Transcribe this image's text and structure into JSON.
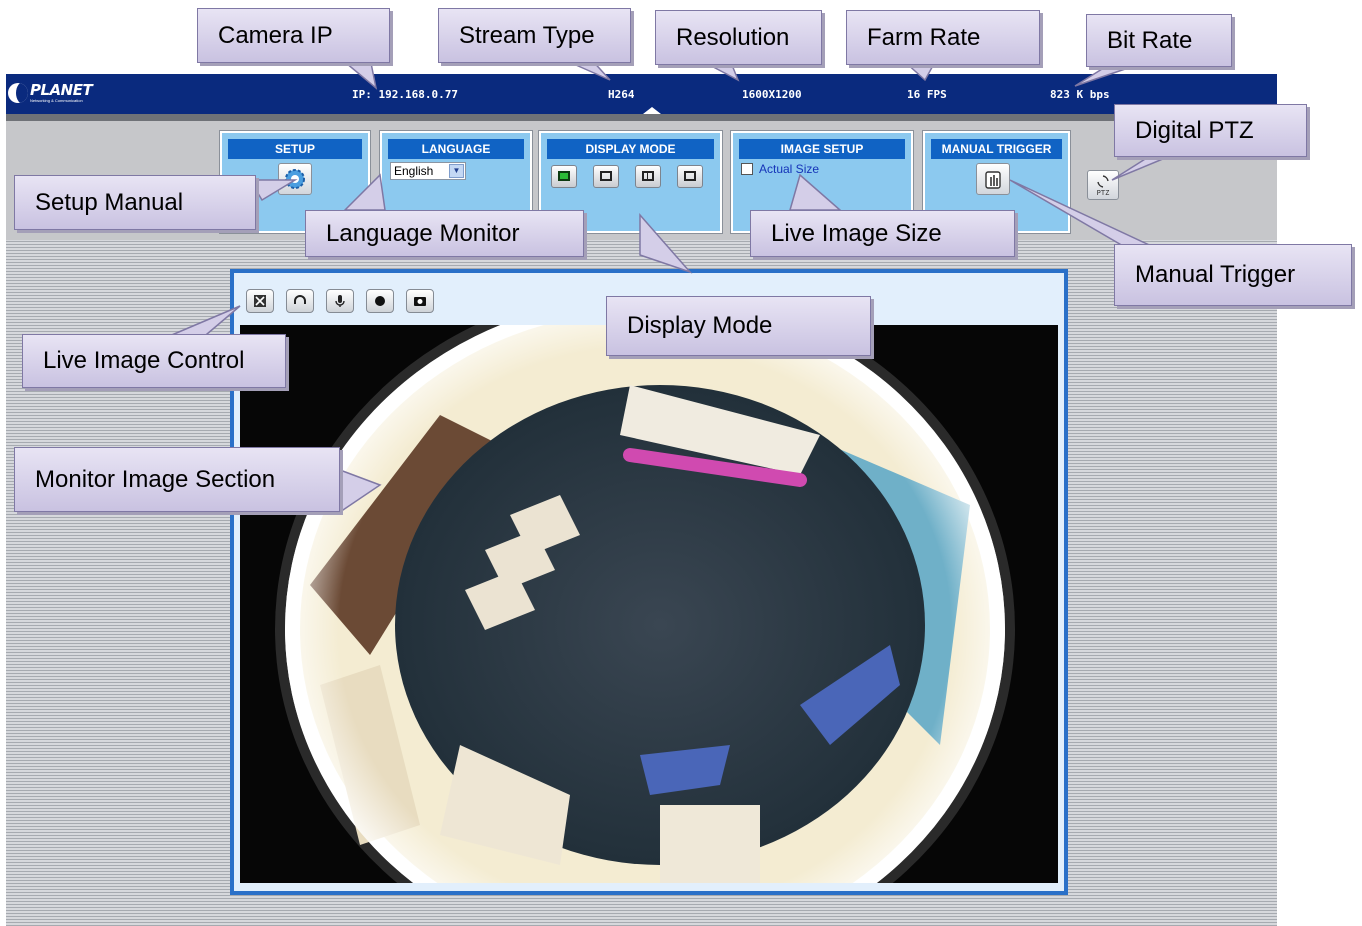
{
  "brand": {
    "name": "PLANET",
    "tagline": "Networking & Communication"
  },
  "status": {
    "ip": "IP: 192.168.0.77",
    "stream_type": "H264",
    "resolution": "1600X1200",
    "frame_rate": "16  FPS",
    "bit_rate": "823  K bps"
  },
  "panels": {
    "setup": {
      "title": "SETUP",
      "icon": "gear-icon"
    },
    "language": {
      "title": "LANGUAGE",
      "selected": "English"
    },
    "display_mode": {
      "title": "DISPLAY MODE",
      "buttons": [
        "fisheye-view-icon",
        "single-view-icon",
        "quad-view-icon",
        "panorama-view-icon"
      ],
      "active_index": 0
    },
    "image_setup": {
      "title": "IMAGE SETUP",
      "actual_size_label": "Actual Size",
      "actual_size_checked": false
    },
    "manual_trigger": {
      "title": "MANUAL TRIGGER",
      "icon": "hand-trigger-icon"
    },
    "digital_ptz": {
      "label": "PTZ",
      "icon": "ptz-icon"
    }
  },
  "live_image_controls": [
    "fullscreen-icon",
    "headphone-icon",
    "microphone-icon",
    "record-icon",
    "snapshot-icon"
  ],
  "callouts": {
    "camera_ip": "Camera IP",
    "stream_type": "Stream Type",
    "resolution": "Resolution",
    "farm_rate": "Farm Rate",
    "bit_rate": "Bit Rate",
    "digital_ptz": "Digital PTZ",
    "setup_manual": "Setup Manual",
    "language_monitor": "Language Monitor",
    "live_image_size": "Live Image Size",
    "manual_trigger": "Manual Trigger",
    "display_mode": "Display Mode",
    "live_image_control": "Live Image Control",
    "monitor_image_section": "Monitor Image Section"
  },
  "colors": {
    "header": "#0a2a7e",
    "panel": "#8cc9ef",
    "panel_title": "#1063c4",
    "monitor_border": "#2a70c8",
    "callout": "#d4cee8"
  }
}
